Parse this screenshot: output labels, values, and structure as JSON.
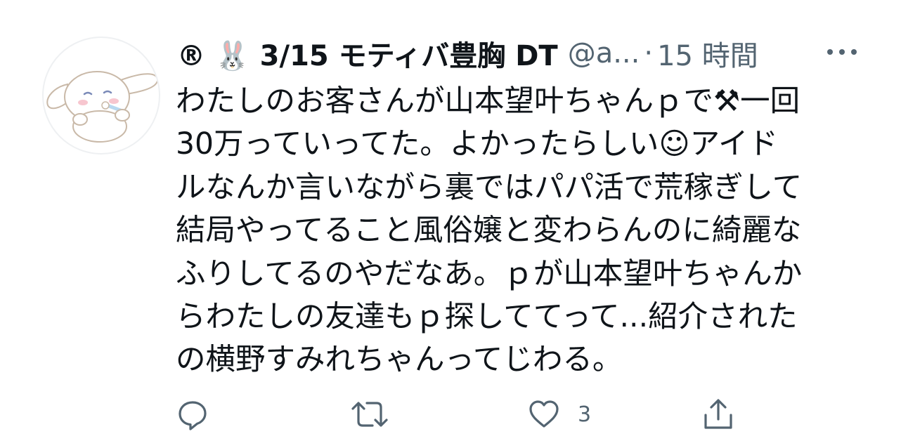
{
  "tweet": {
    "display_name": "® 🐰 3/15 モティバ豊胸 DT",
    "handle": "@a...",
    "separator": "·",
    "time": "15 時間",
    "text_lines": [
      "わたしのお客さんが山本望叶ちゃんｐで⚒一回",
      "30万っていってた。よかったらしい☺アイド",
      "ルなんか言いながら裏ではパパ活で荒稼ぎして",
      "結局やってること風俗嬢と変わらんのに綺麗な",
      "ふりしてるのやだなあ。ｐが山本望叶ちゃんか",
      "らわたしの友達もｐ探しててって...紹介された",
      "の横野すみれちゃんってじわる。"
    ]
  },
  "actions": {
    "like_count": "3",
    "reply_icon": "reply-icon",
    "retweet_icon": "retweet-icon",
    "like_icon": "heart-icon",
    "share_icon": "share-icon"
  },
  "colors": {
    "text": "#0f1419",
    "secondary": "#536471",
    "avatar_border": "#eef0f2"
  }
}
